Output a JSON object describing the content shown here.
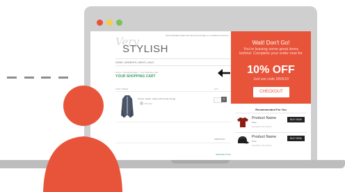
{
  "window": {
    "controls": [
      {
        "name": "close",
        "color": "#e8543a"
      },
      {
        "name": "minimize",
        "color": "#f3d04a"
      },
      {
        "name": "maximize",
        "color": "#7cc05a"
      }
    ]
  },
  "site": {
    "topnav": "Gift Certificates   Wish Lists   My Account   Sign in or Create an Account",
    "logo_script": "Very",
    "logo_text": "STYLISH",
    "category_nav": "HOME  |  WOMEN'S  |  MEN'S  |  SALE",
    "breadcrumb": "Home  >  Shopping Page  >  Your Shopping Cart",
    "cart_title": "YOUR SHOPPING CART",
    "columns": {
      "item": "CART ITEMS",
      "qty": "QTY"
    },
    "item": {
      "name": "Kimber Jacket, Yellow with Purple Fringe",
      "remove_label": "Remove"
    },
    "subtotal_label": "SUBTOTAL",
    "continue_label": "ORANGE TOTE"
  },
  "popup": {
    "title": "Wait! Don't Go!",
    "message": "You're leaving some great items behind. Complete your order now for",
    "discount": "10% OFF",
    "code_text": "Just use code SAVE10",
    "checkout_label": "CHECKOUT",
    "recommended_title": "Recommended For You",
    "products": [
      {
        "name": "Product Name",
        "price": "Price",
        "description": "Description of the product",
        "button": "BUY NOW",
        "icon": "tshirt-icon"
      },
      {
        "name": "Product Name",
        "price": "Price",
        "description": "Description of the product",
        "button": "BUY NOW",
        "icon": "cap-icon"
      }
    ]
  },
  "colors": {
    "accent": "#e8543a",
    "green": "#3aa06a",
    "dark_button": "#222222"
  }
}
